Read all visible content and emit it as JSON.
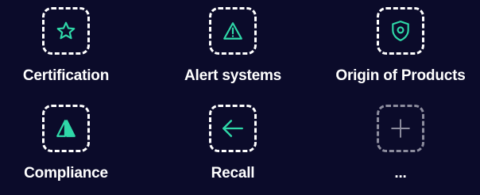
{
  "colors": {
    "background": "#0b0b2a",
    "accent": "#2fd8a8",
    "muted": "#8d8d9e",
    "text": "#ffffff"
  },
  "tiles": [
    {
      "label": "Certification",
      "icon": "star-icon"
    },
    {
      "label": "Alert systems",
      "icon": "warning-triangle-icon"
    },
    {
      "label": "Origin of Products",
      "icon": "location-shield-icon"
    },
    {
      "label": "Compliance",
      "icon": "split-triangle-icon"
    },
    {
      "label": "Recall",
      "icon": "arrow-left-icon"
    },
    {
      "label": "...",
      "icon": "plus-icon"
    }
  ]
}
